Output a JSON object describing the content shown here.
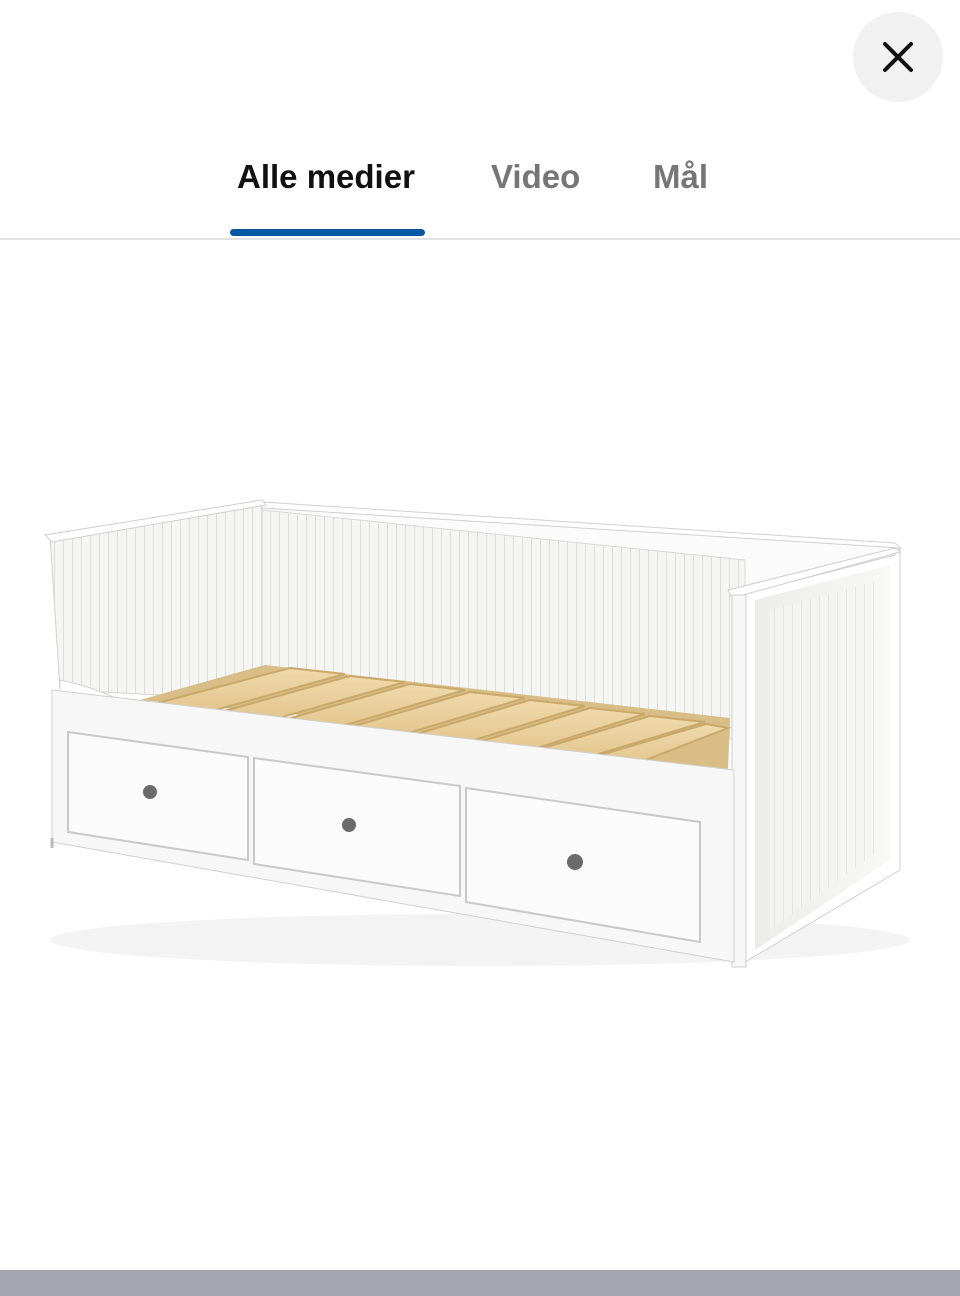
{
  "header": {
    "close_icon": "close-icon"
  },
  "tabs": [
    {
      "label": "Alle medier",
      "active": true
    },
    {
      "label": "Video",
      "active": false
    },
    {
      "label": "Mål",
      "active": false
    }
  ],
  "colors": {
    "active_tab_indicator": "#0058a3",
    "close_button_bg": "#f1f1f1",
    "active_tab_text": "#111111",
    "inactive_tab_text": "#767676"
  },
  "media": {
    "image": "product-photo-daybed-white-with-three-drawers"
  }
}
